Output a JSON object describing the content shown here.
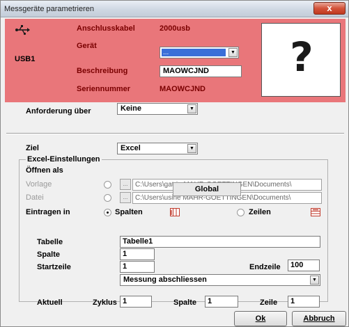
{
  "window": {
    "title": "Messgeräte parametrieren",
    "close_label": "x"
  },
  "header": {
    "device_name": "USB1",
    "labels": {
      "cable": "Anschlusskabel",
      "device": "Gerät",
      "description": "Beschreibung",
      "serial": "Seriennummer"
    },
    "values": {
      "cable": "2000usb",
      "device": "...",
      "description": "MAOWCJND",
      "serial": "MAOWCJND"
    },
    "help_symbol": "?"
  },
  "request": {
    "label": "Anforderung über",
    "value": "Keine"
  },
  "target": {
    "label": "Ziel",
    "value": "Excel"
  },
  "excel": {
    "group_title": "Excel-Einstellungen",
    "open_as": "Öffnen als",
    "template_label": "Vorlage",
    "file_label": "Datei",
    "browse_label": "...",
    "template_path": "C:\\Users\\gatrie MAHR-GOETTINGEN\\Documents\\",
    "file_path": "C:\\Users\\usine MAHR-GOETTINGEN\\Documents\\",
    "tooltip": "Global",
    "enter_in_label": "Eintragen in",
    "columns_label": "Spalten",
    "rows_label": "Zeilen",
    "table_label": "Tabelle",
    "table_value": "Tabelle1",
    "column_label": "Spalte",
    "column_value": "1",
    "start_row_label": "Startzeile",
    "start_row_value": "1",
    "end_row_label": "Endzeile",
    "end_row_value": "100",
    "measure_value": "Messung abschliessen"
  },
  "current": {
    "label": "Aktuell",
    "cycle_label": "Zyklus",
    "cycle_value": "1",
    "column_label": "Spalte",
    "column_value": "1",
    "row_label": "Zeile",
    "row_value": "1"
  },
  "buttons": {
    "ok": "Ok",
    "cancel": "Abbruch"
  },
  "colors": {
    "header_bg": "#e9767a",
    "header_text": "#7a0000",
    "selection": "#3a6fd8"
  }
}
